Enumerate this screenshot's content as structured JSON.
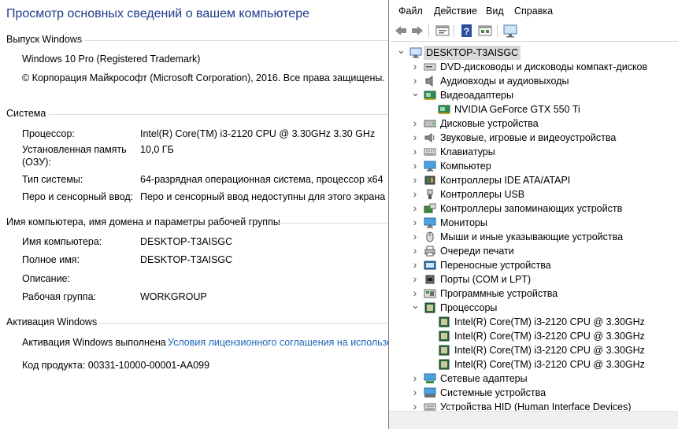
{
  "system": {
    "heading": "Просмотр основных сведений о вашем компьютере",
    "edition": {
      "title": "Выпуск Windows",
      "name": "Windows 10 Pro (Registered Trademark)",
      "copyright": "© Корпорация Майкрософт (Microsoft Corporation), 2016. Все права защищены."
    },
    "sys": {
      "title": "Система",
      "rows": [
        {
          "label": "Процессор:",
          "value": "Intel(R) Core(TM) i3-2120 CPU @ 3.30GHz   3.30 GHz"
        },
        {
          "label": "Установленная память\n(ОЗУ):",
          "value": "10,0 ГБ"
        },
        {
          "label": "Тип системы:",
          "value": "64-разрядная операционная система, процессор x64"
        },
        {
          "label": "Перо и сенсорный ввод:",
          "value": "Перо и сенсорный ввод недоступны для этого экрана"
        }
      ]
    },
    "computer": {
      "title": "Имя компьютера, имя домена и параметры рабочей группы",
      "rows": [
        {
          "label": "Имя компьютера:",
          "value": "DESKTOP-T3AISGC"
        },
        {
          "label": "Полное имя:",
          "value": "DESKTOP-T3AISGC"
        },
        {
          "label": "Описание:",
          "value": ""
        },
        {
          "label": "Рабочая группа:",
          "value": "WORKGROUP"
        }
      ]
    },
    "activation": {
      "title": "Активация Windows",
      "status": "Активация Windows выполнена",
      "link": "Условия лицензионного соглашения на использов",
      "product_key": "Код продукта:  00331-10000-00001-AA099"
    }
  },
  "devmgr": {
    "menu": [
      "Файл",
      "Действие",
      "Вид",
      "Справка"
    ],
    "toolbar_icons": [
      "back-arrow-icon",
      "forward-arrow-icon",
      "properties-icon",
      "help-icon",
      "view-icon",
      "monitor-icon"
    ],
    "root": "DESKTOP-T3AISGC",
    "categories": [
      {
        "label": "DVD-дисководы и дисководы компакт-дисков",
        "icon": "dvd-icon",
        "expanded": false
      },
      {
        "label": "Аудиовходы и аудиовыходы",
        "icon": "speaker-icon",
        "expanded": false
      },
      {
        "label": "Видеоадаптеры",
        "icon": "display-adapter-icon",
        "expanded": true,
        "children": [
          "NVIDIA GeForce GTX 550 Ti"
        ]
      },
      {
        "label": "Дисковые устройства",
        "icon": "disk-icon",
        "expanded": false
      },
      {
        "label": "Звуковые, игровые и видеоустройства",
        "icon": "sound-icon",
        "expanded": false
      },
      {
        "label": "Клавиатуры",
        "icon": "keyboard-icon",
        "expanded": false
      },
      {
        "label": "Компьютер",
        "icon": "computer-icon",
        "expanded": false
      },
      {
        "label": "Контроллеры IDE ATA/ATAPI",
        "icon": "ide-icon",
        "expanded": false
      },
      {
        "label": "Контроллеры USB",
        "icon": "usb-icon",
        "expanded": false
      },
      {
        "label": "Контроллеры запоминающих устройств",
        "icon": "storage-icon",
        "expanded": false
      },
      {
        "label": "Мониторы",
        "icon": "monitor-icon",
        "expanded": false
      },
      {
        "label": "Мыши и иные указывающие устройства",
        "icon": "mouse-icon",
        "expanded": false
      },
      {
        "label": "Очереди печати",
        "icon": "printer-icon",
        "expanded": false
      },
      {
        "label": "Переносные устройства",
        "icon": "portable-icon",
        "expanded": false
      },
      {
        "label": "Порты (COM и LPT)",
        "icon": "port-icon",
        "expanded": false
      },
      {
        "label": "Программные устройства",
        "icon": "software-icon",
        "expanded": false
      },
      {
        "label": "Процессоры",
        "icon": "processor-icon",
        "expanded": true,
        "children": [
          "Intel(R) Core(TM) i3-2120 CPU @ 3.30GHz",
          "Intel(R) Core(TM) i3-2120 CPU @ 3.30GHz",
          "Intel(R) Core(TM) i3-2120 CPU @ 3.30GHz",
          "Intel(R) Core(TM) i3-2120 CPU @ 3.30GHz"
        ]
      },
      {
        "label": "Сетевые адаптеры",
        "icon": "network-icon",
        "expanded": false
      },
      {
        "label": "Системные устройства",
        "icon": "system-icon",
        "expanded": false
      },
      {
        "label": "Устройства HID (Human Interface Devices)",
        "icon": "hid-icon",
        "expanded": false
      }
    ]
  },
  "colors": {
    "heading": "#1e3b8a",
    "link": "#1a66b8",
    "selection": "#d9d9d9"
  }
}
